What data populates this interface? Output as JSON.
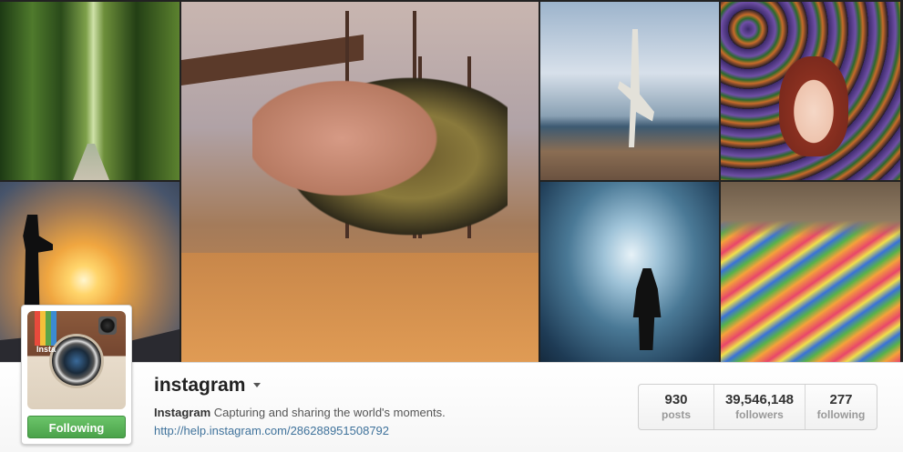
{
  "profile": {
    "username": "instagram",
    "display_name": "Instagram",
    "bio": "Capturing and sharing the world's moments.",
    "link": "http://help.instagram.com/286288951508792",
    "follow_button": "Following",
    "avatar_text": "Insta"
  },
  "stats": [
    {
      "value": "930",
      "label": "posts"
    },
    {
      "value": "39,546,148",
      "label": "followers"
    },
    {
      "value": "277",
      "label": "following"
    }
  ],
  "colors": {
    "follow_green": "#4aa24a",
    "link_blue": "#3f729b"
  }
}
